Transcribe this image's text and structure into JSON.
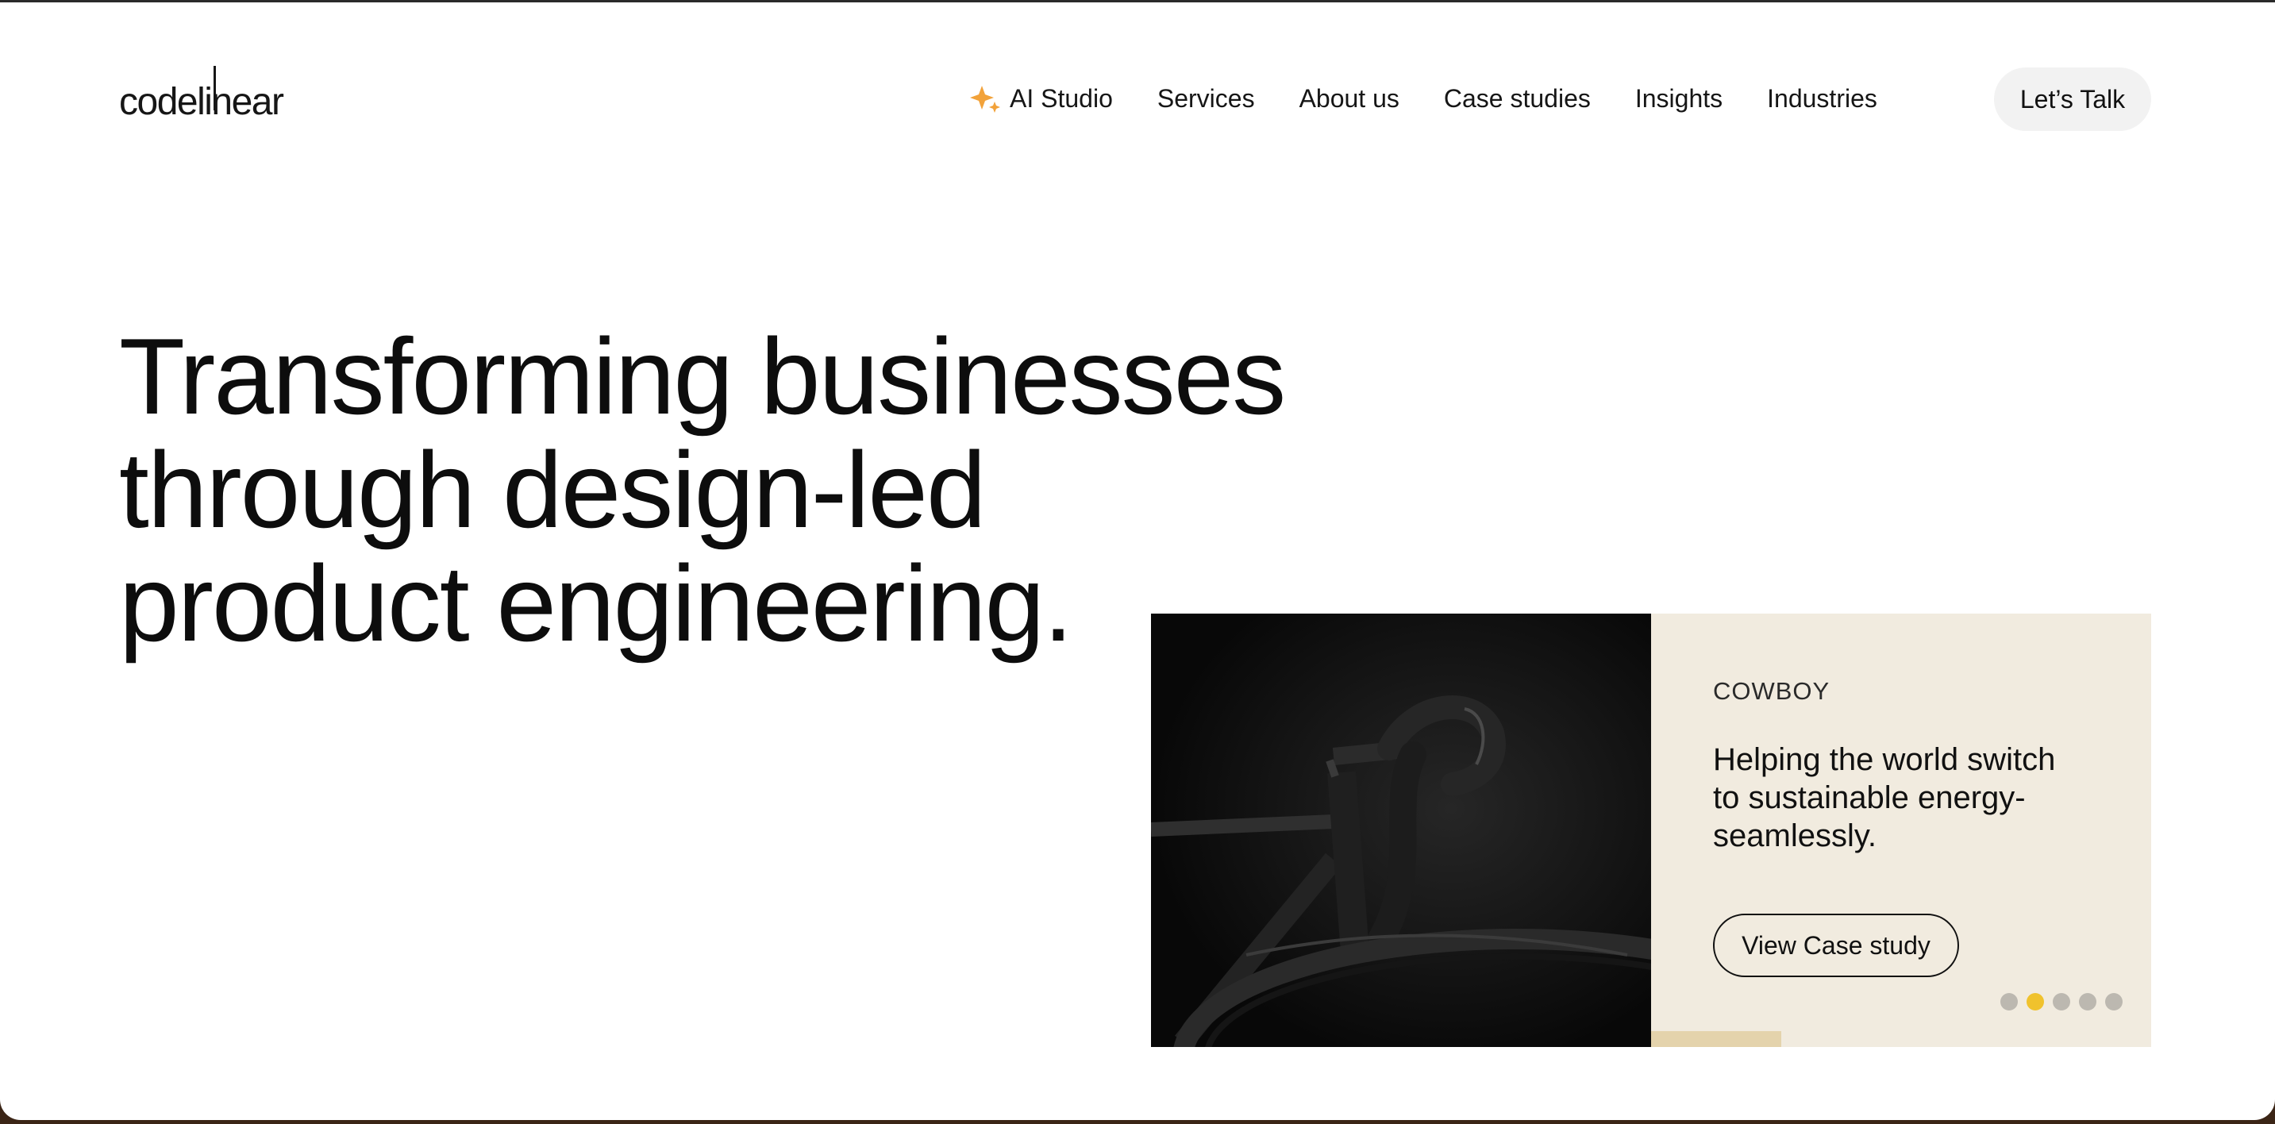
{
  "brand": {
    "logo_text": "codelinear"
  },
  "nav": {
    "items": [
      {
        "label": "AI Studio",
        "icon": "sparkle-icon"
      },
      {
        "label": "Services"
      },
      {
        "label": "About us"
      },
      {
        "label": "Case studies"
      },
      {
        "label": "Insights"
      },
      {
        "label": "Industries"
      }
    ],
    "cta_label": "Let’s Talk"
  },
  "hero": {
    "lines": [
      "Transforming businesses",
      "through design-led",
      "product engineering."
    ]
  },
  "case_card": {
    "client": "COWBOY",
    "headline": "Helping the world switch to sustainable energy- seamlessly.",
    "button_label": "View Case study",
    "slides_total": 5,
    "active_slide": 2,
    "image_icon": "bicycle-handlebar-photo",
    "slide_progress": 0.26
  },
  "colors": {
    "accent": "#f0c22d",
    "spark": "#f2a23a",
    "card_bg": "#f1ebdf",
    "progress": "#e4d3ac",
    "dot": "#bcb8b0",
    "cta_bg": "#f2f2f2"
  }
}
